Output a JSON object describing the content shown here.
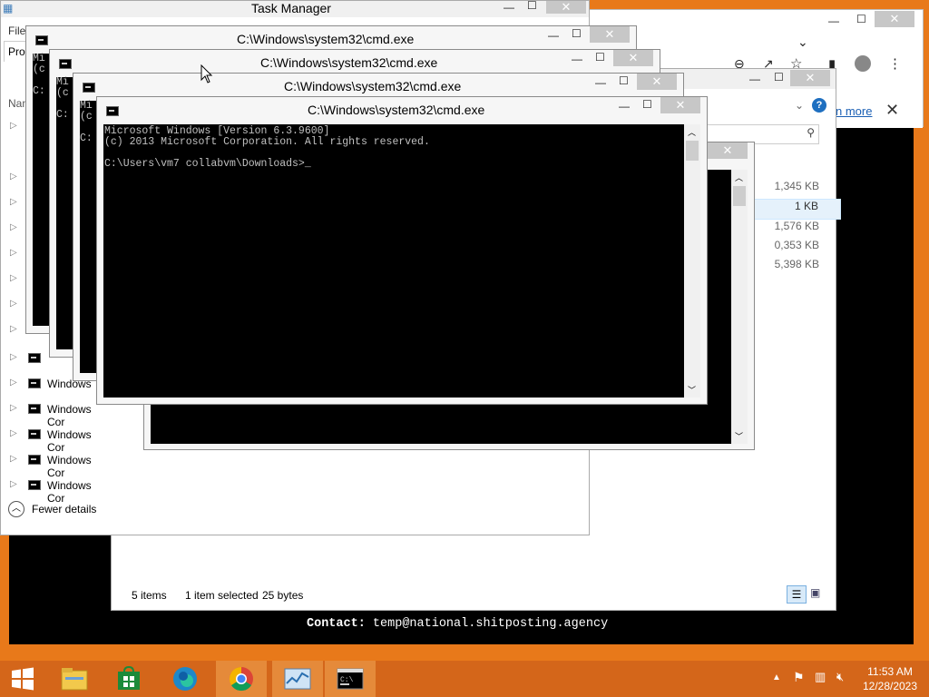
{
  "taskbar": {
    "time": "11:53 AM",
    "date": "12/28/2023"
  },
  "task_manager": {
    "title": "Task Manager",
    "menu_file": "File",
    "tab_processes": "Pro",
    "col_name": "Nam",
    "rows": [
      "Windows",
      "Windows Cor",
      "Windows Cor",
      "Windows Cor",
      "Windows Cor"
    ],
    "fewer_details": "Fewer details"
  },
  "cmd_windows": {
    "title": "C:\\Windows\\system32\\cmd.exe",
    "line1": "Microsoft Windows [Version 6.3.9600]",
    "line2": "(c) 2013 Microsoft Corporation. All rights reserved.",
    "prompt": "C:\\Users\\vm7 collabvm\\Downloads>",
    "cursor": "_",
    "bg_line1": "Mi",
    "bg_line2": "(c",
    "bg_line3": "C:"
  },
  "explorer": {
    "sizes": [
      "1,345 KB",
      "1 KB",
      "1,576 KB",
      "0,353 KB",
      "5,398 KB"
    ],
    "status_items": "5 items",
    "status_selected": "1 item selected",
    "status_size": "25 bytes"
  },
  "browser": {
    "learn_more": "n more"
  },
  "background_console": {
    "contact_label": "Contact:",
    "contact_value": "temp@national.shitposting.agency"
  },
  "colors": {
    "desktop": "#e8791a",
    "taskbar": "#d4661a",
    "accent_blue": "#1e6fc0"
  }
}
